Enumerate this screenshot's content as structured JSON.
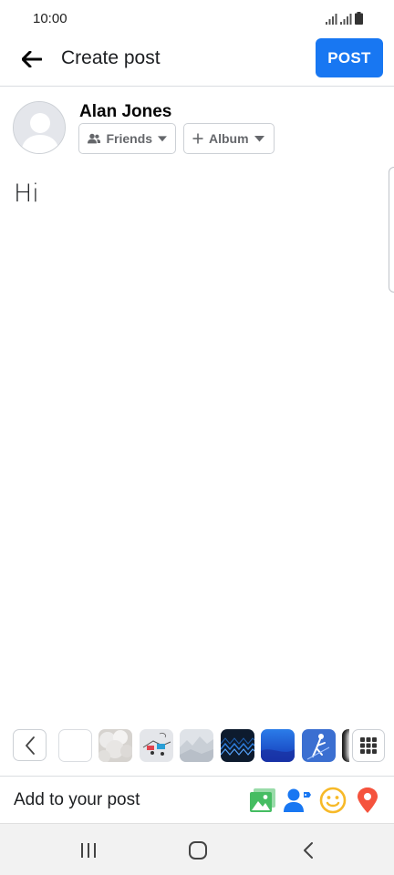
{
  "status_bar": {
    "time": "10:00"
  },
  "header": {
    "title": "Create post",
    "post_label": "POST"
  },
  "author": {
    "name": "Alan Jones",
    "audience_label": "Friends",
    "album_label": "Album"
  },
  "composer": {
    "text": "Hi"
  },
  "backgrounds": {
    "icons": [
      "chevron-left-icon",
      "grid-icon"
    ],
    "swatches": [
      "white",
      "cotton",
      "illustration",
      "mountains",
      "dark-pattern",
      "blue-gradient",
      "blue-figure",
      "black-split"
    ]
  },
  "add_to_post": {
    "label": "Add to your post",
    "icons": [
      "photo-icon",
      "tag-people-icon",
      "feeling-icon",
      "location-icon"
    ]
  },
  "colors": {
    "accent": "#1877f2",
    "photo_green": "#45bd62",
    "feeling_yellow": "#f7b928",
    "location_red": "#f5533d"
  }
}
